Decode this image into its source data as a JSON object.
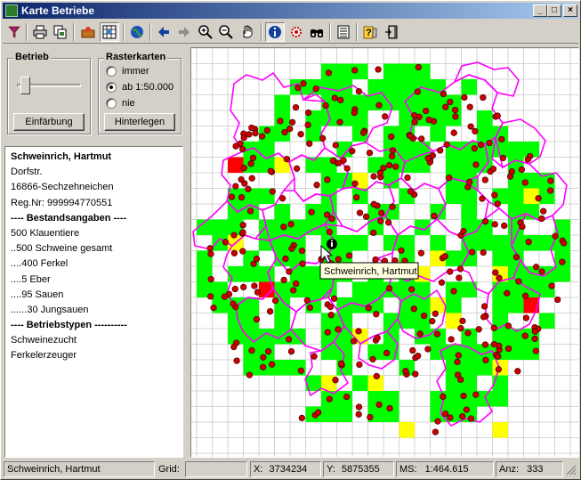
{
  "window": {
    "title": "Karte Betriebe"
  },
  "toolbar": {
    "buttons": [
      {
        "icon": "filter-icon"
      },
      {
        "icon": "print-icon"
      },
      {
        "icon": "copy-icon"
      },
      {
        "icon": "open-icon"
      },
      {
        "icon": "grid-icon"
      },
      {
        "icon": "globe-icon"
      },
      {
        "icon": "arrow-left-icon"
      },
      {
        "icon": "arrow-right-icon"
      },
      {
        "icon": "zoom-in-icon"
      },
      {
        "icon": "zoom-out-icon"
      },
      {
        "icon": "hand-icon"
      },
      {
        "icon": "info-icon"
      },
      {
        "icon": "gear-icon"
      },
      {
        "icon": "binoculars-icon"
      },
      {
        "icon": "list-icon"
      },
      {
        "icon": "help-icon"
      },
      {
        "icon": "exit-icon"
      }
    ]
  },
  "betrieb": {
    "title": "Betrieb",
    "button": "Einfärbung"
  },
  "rasterkarten": {
    "title": "Rasterkarten",
    "options": [
      "immer",
      "ab 1:50.000",
      "nie"
    ],
    "selected": "ab 1:50.000",
    "button": "Hinterlegen"
  },
  "info": {
    "lines": [
      {
        "text": "Schweinrich, Hartmut",
        "bold": true
      },
      {
        "text": "Dorfstr.",
        "bold": false
      },
      {
        "text": "16866-Sechzehneichen",
        "bold": false
      },
      {
        "text": "Reg.Nr: 999994770551",
        "bold": false
      },
      {
        "text": "---- Bestandsangaben ----",
        "bold": true
      },
      {
        "text": "500 Klauentiere",
        "bold": false
      },
      {
        "text": "..500 Schweine gesamt",
        "bold": false
      },
      {
        "text": "....400 Ferkel",
        "bold": false
      },
      {
        "text": "....5 Eber",
        "bold": false
      },
      {
        "text": "....95 Sauen",
        "bold": false
      },
      {
        "text": "......30 Jungsauen",
        "bold": false
      },
      {
        "text": "---- Betriebstypen ----------",
        "bold": true
      },
      {
        "text": "Schweinezucht",
        "bold": false
      },
      {
        "text": "Ferkelerzeuger",
        "bold": false
      }
    ]
  },
  "map": {
    "tooltip": "Schweinrich, Hartmut",
    "colors": {
      "grid": "#c8c8c8",
      "cell_green": "#00ff00",
      "cell_yellow": "#ffff00",
      "cell_red": "#ff0000",
      "boundary": "#ff00ff",
      "dot": "#cc0000"
    }
  },
  "status": {
    "name": "Schweinrich, Hartmut",
    "grid_label": "Grid:",
    "grid_value": "",
    "x_label": "X:",
    "x_value": "3734234",
    "y_label": "Y:",
    "y_value": "5875355",
    "ms_label": "MS:",
    "ms_value": "1:464.615",
    "anz_label": "Anz:",
    "anz_value": "333"
  }
}
